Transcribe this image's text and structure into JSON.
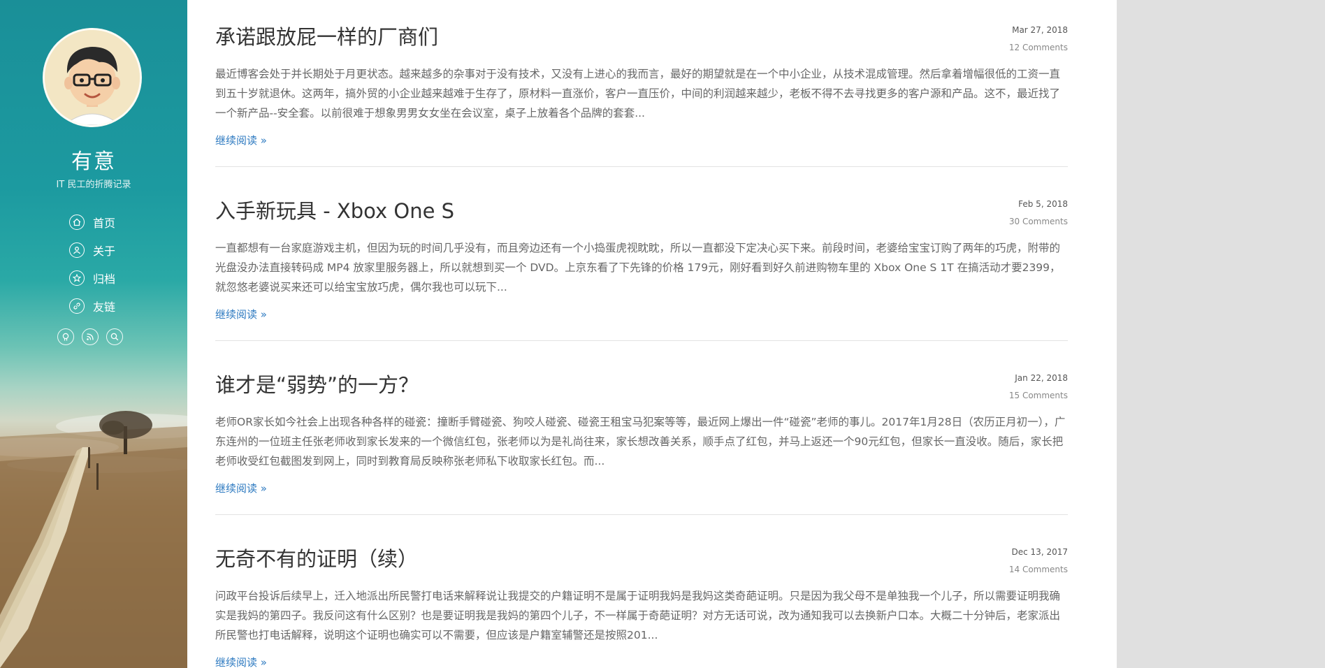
{
  "sidebar": {
    "site_title": "有意",
    "site_subtitle": "IT 民工的折腾记录",
    "nav": [
      {
        "label": "首页",
        "icon": "home-icon"
      },
      {
        "label": "关于",
        "icon": "user-icon"
      },
      {
        "label": "归档",
        "icon": "star-icon"
      },
      {
        "label": "友链",
        "icon": "link-icon"
      }
    ],
    "social": [
      {
        "icon": "github-icon"
      },
      {
        "icon": "rss-icon"
      },
      {
        "icon": "search-icon"
      }
    ]
  },
  "posts": [
    {
      "title": "承诺跟放屁一样的厂商们",
      "date": "Mar 27, 2018",
      "comments": "12 Comments",
      "excerpt": "最近博客会处于并长期处于月更状态。越来越多的杂事对于没有技术，又没有上进心的我而言，最好的期望就是在一个中小企业，从技术混成管理。然后拿着增幅很低的工资一直到五十岁就退休。这两年，搞外贸的小企业越来越难于生存了，原材料一直涨价，客户一直压价，中间的利润越来越少，老板不得不去寻找更多的客户源和产品。这不，最近找了一个新产品--安全套。以前很难于想象男男女女坐在会议室，桌子上放着各个品牌的套套...",
      "read_more": "继续阅读 »"
    },
    {
      "title": "入手新玩具 - Xbox One S",
      "date": "Feb 5, 2018",
      "comments": "30 Comments",
      "excerpt": "一直都想有一台家庭游戏主机，但因为玩的时间几乎没有，而且旁边还有一个小捣蛋虎视眈眈，所以一直都没下定决心买下来。前段时间，老婆给宝宝订购了两年的巧虎，附带的光盘没办法直接转码成 MP4 放家里服务器上，所以就想到买一个 DVD。上京东看了下先锋的价格 179元，刚好看到好久前进购物车里的 Xbox One S 1T 在搞活动才要2399，就忽悠老婆说买来还可以给宝宝放巧虎，偶尔我也可以玩下...",
      "read_more": "继续阅读 »"
    },
    {
      "title": "谁才是“弱势”的一方？",
      "date": "Jan 22, 2018",
      "comments": "15 Comments",
      "excerpt": "老师OR家长如今社会上出现各种各样的碰瓷：撞断手臂碰瓷、狗咬人碰瓷、碰瓷王租宝马犯案等等，最近网上爆出一件“碰瓷”老师的事儿。2017年1月28日（农历正月初一），广东连州的一位班主任张老师收到家长发来的一个微信红包，张老师以为是礼尚往来，家长想改善关系，顺手点了红包，并马上返还一个90元红包，但家长一直没收。随后，家长把老师收受红包截图发到网上，同时到教育局反映称张老师私下收取家长红包。而...",
      "read_more": "继续阅读 »"
    },
    {
      "title": "无奇不有的证明（续）",
      "date": "Dec 13, 2017",
      "comments": "14 Comments",
      "excerpt": "问政平台投诉后续早上，迁入地派出所民警打电话来解释说让我提交的户籍证明不是属于证明我妈是我妈这类奇葩证明。只是因为我父母不是单独我一个儿子，所以需要证明我确实是我妈的第四子。我反问这有什么区别？也是要证明我是我妈的第四个儿子，不一样属于奇葩证明？对方无话可说，改为通知我可以去换新户口本。大概二十分钟后，老家派出所民警也打电话解释，说明这个证明也确实可以不需要，但应该是户籍室辅警还是按照201...",
      "read_more": "继续阅读 »"
    }
  ]
}
